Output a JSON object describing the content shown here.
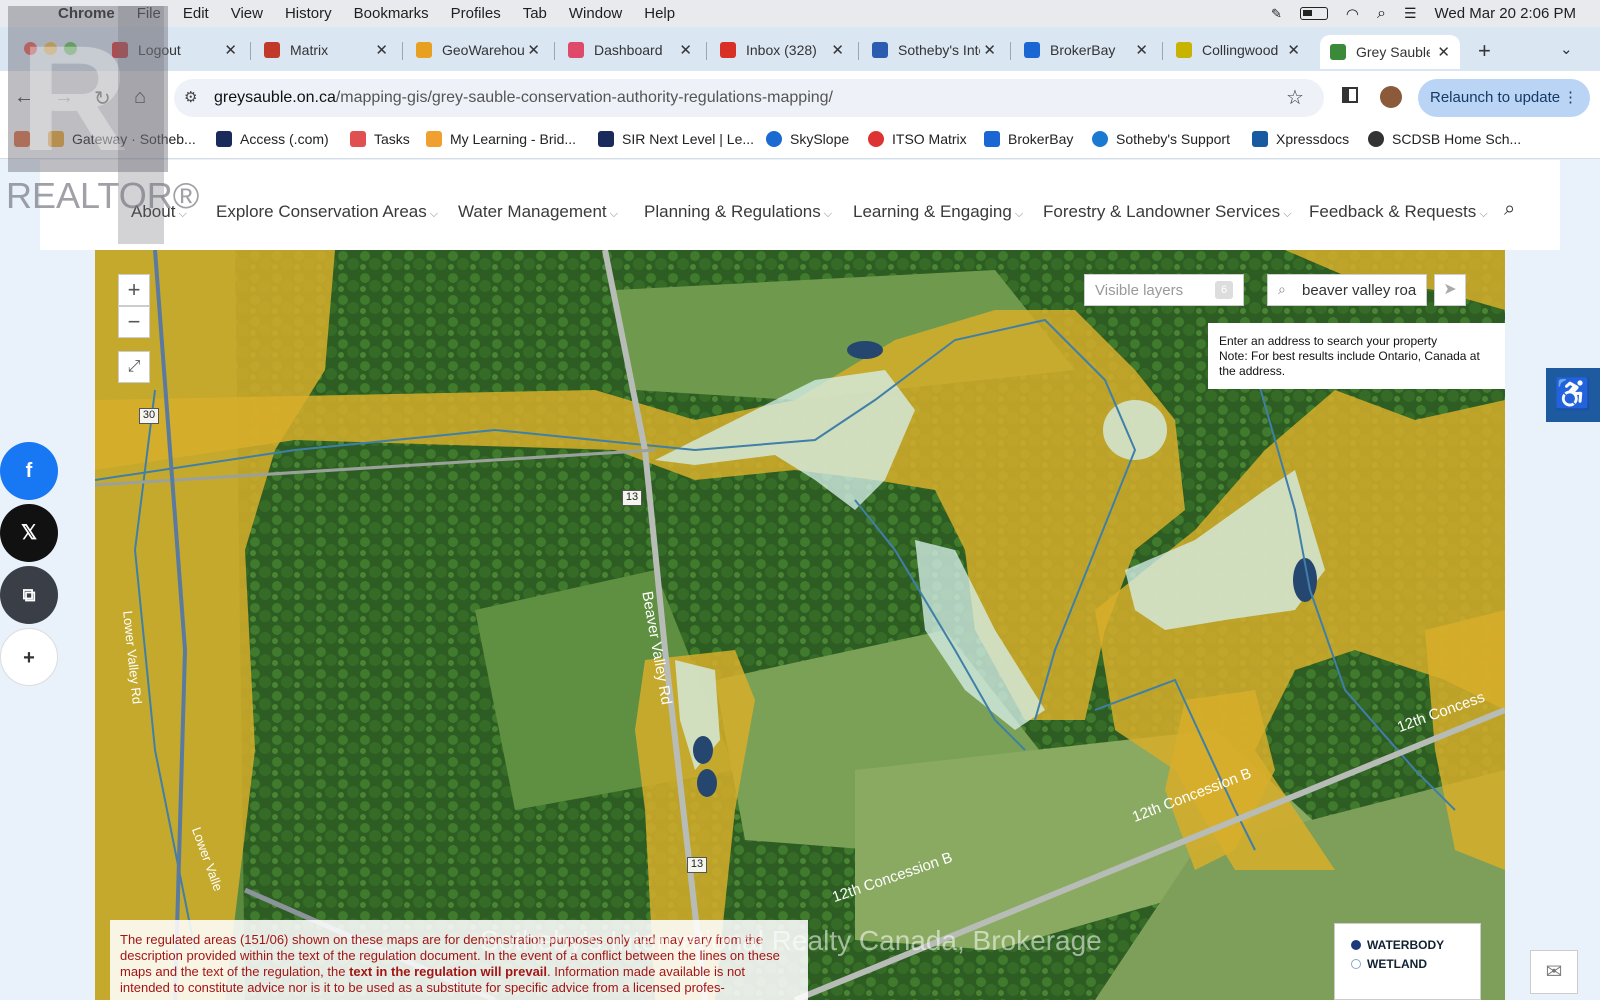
{
  "menubar": {
    "items": [
      "Chrome",
      "File",
      "Edit",
      "View",
      "History",
      "Bookmarks",
      "Profiles",
      "Tab",
      "Window",
      "Help"
    ],
    "datetime": "Wed Mar 20  2:06 PM"
  },
  "tabs": [
    {
      "label": "Logout",
      "color": "#d33"
    },
    {
      "label": "Matrix",
      "color": "#c0392b"
    },
    {
      "label": "GeoWarehouse",
      "color": "#e8a020"
    },
    {
      "label": "Dashboard",
      "color": "#e04a6a"
    },
    {
      "label": "Inbox (328)",
      "color": "#d93025"
    },
    {
      "label": "Sotheby's International",
      "color": "#2a5db0"
    },
    {
      "label": "BrokerBay",
      "color": "#1a66d2"
    },
    {
      "label": "Collingwood",
      "color": "#c8b400"
    },
    {
      "label": "Grey Sauble",
      "color": "#3a8a3a"
    }
  ],
  "address_bar": {
    "host": "greysauble.on.ca",
    "path": "/mapping-gis/grey-sauble-conservation-authority-regulations-mapping/",
    "relaunch_label": "Relaunch to update"
  },
  "bookmarks": [
    {
      "label": "Gateway · Sotheb...",
      "color": "#f0a830"
    },
    {
      "label": "Access (.com)",
      "color": "#1a2a5a"
    },
    {
      "label": "Tasks",
      "color": "#e05050"
    },
    {
      "label": "My Learning - Brid...",
      "color": "#f0a030"
    },
    {
      "label": "SIR Next Level | Le...",
      "color": "#1a2a5a"
    },
    {
      "label": "SkySlope",
      "color": "#1a6ad2"
    },
    {
      "label": "ITSO Matrix",
      "color": "#d33"
    },
    {
      "label": "BrokerBay",
      "color": "#1a66d2"
    },
    {
      "label": "Sotheby's Support",
      "color": "#1a7ad2"
    },
    {
      "label": "Xpressdocs",
      "color": "#1a5aa0"
    },
    {
      "label": "SCDSB Home Sch...",
      "color": "#333"
    }
  ],
  "site_nav": [
    "About",
    "Explore Conservation Areas",
    "Water Management",
    "Planning & Regulations",
    "Learning & Engaging",
    "Forestry & Landowner Services",
    "Feedback & Requests"
  ],
  "map": {
    "zoom_in": "+",
    "zoom_out": "−",
    "layers_placeholder": "Visible layers",
    "layers_count": "6",
    "search_value": "beaver valley roa",
    "tip_line1": "Enter an address to search your property",
    "tip_line2": "Note: For best results include Ontario, Canada at the address.",
    "roads": [
      "Lower Valley Rd",
      "Beaver Valley Rd",
      "12th Concession B",
      "12th Concession B",
      "12th Concess",
      "Lower Valle"
    ],
    "route_shields": [
      "30",
      "13",
      "13"
    ],
    "legend": [
      "WATERBODY",
      "WETLAND"
    ],
    "legend_colors": [
      "#1a3a7a",
      "#d8f0f0"
    ],
    "disclaimer_pre": "The regulated areas (151/06) shown on these maps are for demonstration purposes only and may vary from the description provided within the text of the regulation document. In the event of a conflict between the lines on these maps and the text of the regulation, the ",
    "disclaimer_bold": "text in the regulation will prevail",
    "disclaimer_post": ". Information made available is not intended to constitute advice nor is it to be used as a substitute for specific advice from a licensed profes-"
  },
  "watermark": "Sotheby's International Realty Canada, Brokerage",
  "realtor_logo": "REALTOR®"
}
